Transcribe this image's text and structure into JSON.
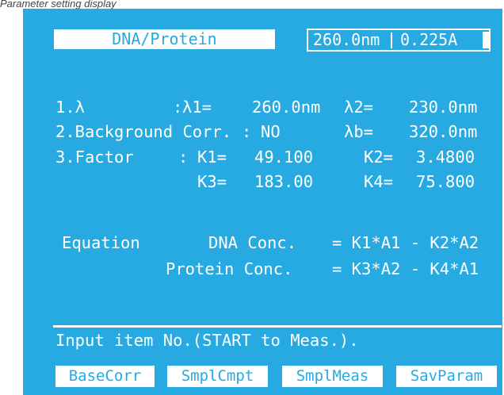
{
  "caption": "Parameter setting display",
  "header": {
    "mode_label": "DNA/Protein",
    "wavelength": "260.0nm",
    "absorbance": "0.225A"
  },
  "params": {
    "row1": {
      "label": "1.λ",
      "sep": ":",
      "k_a": "λ1=",
      "v_a": "260.0nm",
      "k_b": "λ2=",
      "v_b": "230.0nm"
    },
    "row2": {
      "label": "2.Background Corr.",
      "sep": ":",
      "v_a": "NO",
      "k_b": "λb=",
      "v_b": "320.0nm"
    },
    "row3": {
      "label": "3.Factor",
      "sep": ":",
      "k_a": "K1=",
      "v_a": "49.100",
      "k_b": "K2=",
      "v_b": "3.4800"
    },
    "row4": {
      "k_a": "K3=",
      "v_a": "183.00",
      "k_b": "K4=",
      "v_b": "75.800"
    }
  },
  "equation": {
    "label": "Equation",
    "line1_name": "DNA Conc.",
    "line1_expr": "= K1*A1 - K2*A2",
    "line2_name": "Protein Conc.",
    "line2_expr": "= K3*A2 - K4*A1"
  },
  "prompt": "Input item No.(START to Meas.).",
  "function_keys": [
    "BaseCorr",
    "SmplCmpt",
    "SmplMeas",
    "SavParam"
  ],
  "colors": {
    "screen_bg": "#27a9e1",
    "text": "#ffffff"
  }
}
